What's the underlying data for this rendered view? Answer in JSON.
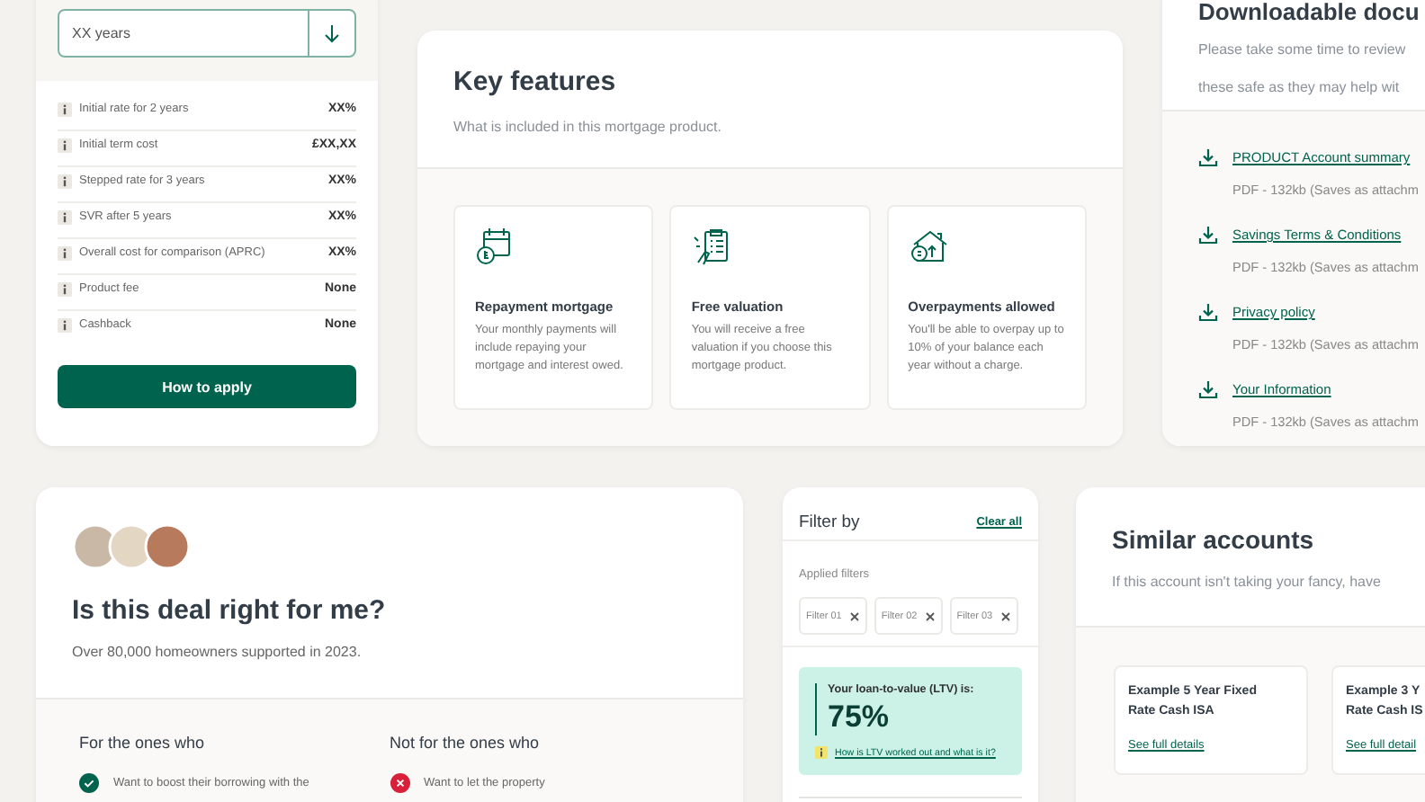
{
  "rate_card": {
    "term_select": {
      "value": "XX years"
    },
    "rows": [
      {
        "label": "Initial rate for 2 years",
        "value": "XX%"
      },
      {
        "label": "Initial term cost",
        "value": "£XX,XX"
      },
      {
        "label": "Stepped rate for 3 years",
        "value": "XX%"
      },
      {
        "label": "SVR after 5 years",
        "value": "XX%"
      },
      {
        "label": "Overall cost for comparison (APRC)",
        "value": "XX%"
      },
      {
        "label": "Product fee",
        "value": "None"
      },
      {
        "label": "Cashback",
        "value": "None"
      }
    ],
    "apply_button": "How to apply"
  },
  "key_features": {
    "title": "Key features",
    "subtitle": "What is included in this mortgage product.",
    "features": [
      {
        "kind": "calendar",
        "title": "Repayment mortgage",
        "description": "Your monthly payments will include repaying your mortgage and interest owed."
      },
      {
        "kind": "checklist",
        "title": "Free valuation",
        "description": "You will receive a free valuation if you choose this mortgage product."
      },
      {
        "kind": "house",
        "title": "Overpayments allowed",
        "description": "You'll be able to overpay up to 10% of your balance each  year without a charge."
      }
    ]
  },
  "documents": {
    "title": "Downloadable docu",
    "description_lines": [
      "Please take some time to review",
      "these safe as they may help wit"
    ],
    "items": [
      {
        "link": "PRODUCT Account summary",
        "meta": "PDF - 132kb (Saves as attachm"
      },
      {
        "link": "Savings Terms & Conditions",
        "meta": "PDF - 132kb (Saves as attachm"
      },
      {
        "link": "Privacy policy",
        "meta": "PDF - 132kb (Saves as attachm"
      },
      {
        "link": "Your Information",
        "meta": "PDF - 132kb (Saves as attachm"
      }
    ]
  },
  "deal_check": {
    "title": "Is this deal right for me?",
    "subtitle": "Over 80,000 homeowners supported in 2023.",
    "columns": [
      {
        "kind": "for",
        "heading": "For the ones who",
        "items": [
          "Want to boost their borrowing with the"
        ]
      },
      {
        "kind": "against",
        "heading": "Not for the ones who",
        "items": [
          "Want to let the property"
        ]
      }
    ]
  },
  "filter": {
    "title": "Filter by",
    "clear": "Clear all",
    "applied_label": "Applied filters",
    "chips": [
      "Filter 01",
      "Filter 02",
      "Filter 03"
    ],
    "ltv": {
      "label": "Your loan-to-value (LTV) is:",
      "value": "75%",
      "help_link": "How is LTV worked out and what is it?"
    }
  },
  "similar": {
    "title": "Similar accounts",
    "subtitle": "If this account isn't taking your fancy, have",
    "accounts": [
      {
        "name_lines": [
          "Example 5 Year Fixed",
          "Rate Cash ISA"
        ],
        "link": "See full details"
      },
      {
        "name_lines": [
          "Example 3 Y",
          "Rate Cash IS"
        ],
        "link": "See full detail"
      }
    ]
  }
}
